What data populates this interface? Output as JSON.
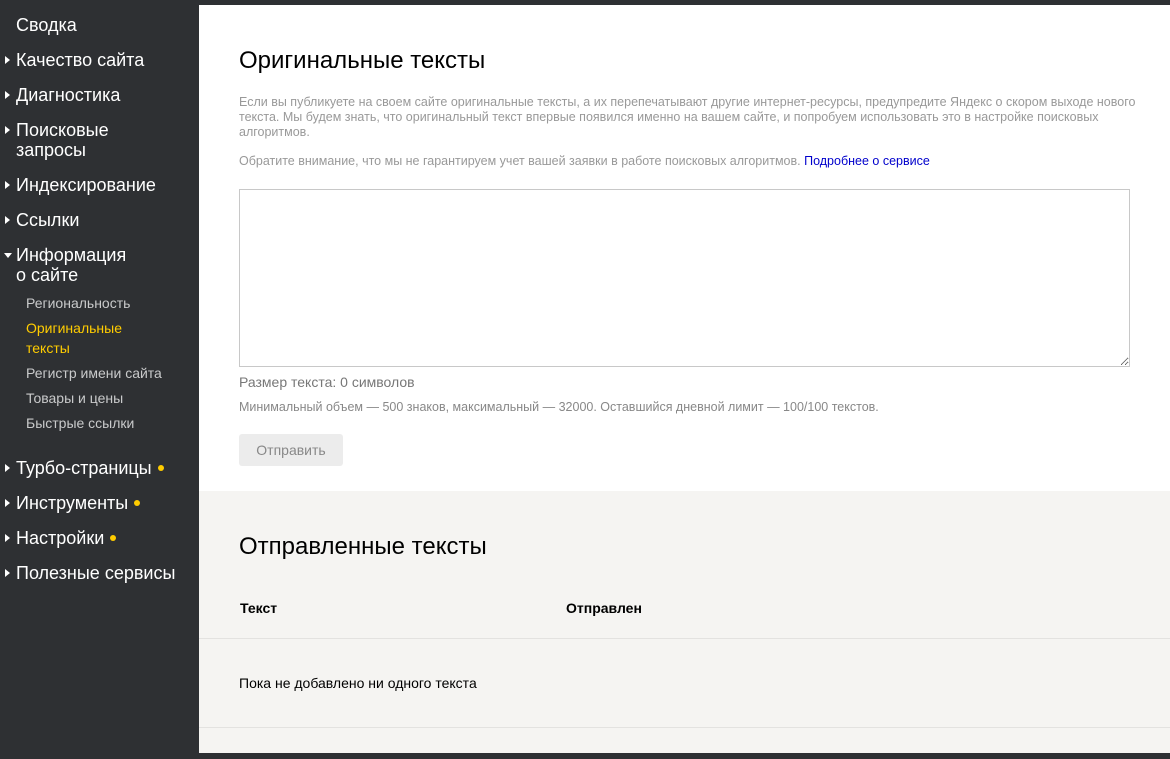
{
  "sidebar": {
    "items": [
      {
        "label": "Сводка"
      },
      {
        "label": "Качество сайта"
      },
      {
        "label": "Диагностика"
      },
      {
        "label_line1": "Поисковые",
        "label_line2": "запросы"
      },
      {
        "label": "Индексирование"
      },
      {
        "label": "Ссылки"
      },
      {
        "label_line1": "Информация",
        "label_line2": "о сайте"
      },
      {
        "label": "Турбо-страницы"
      },
      {
        "label": "Инструменты"
      },
      {
        "label": "Настройки"
      },
      {
        "label": "Полезные сервисы"
      }
    ],
    "subitems": [
      {
        "label": "Региональность"
      },
      {
        "label_line1": "Оригинальные",
        "label_line2": "тексты"
      },
      {
        "label": "Регистр имени сайта"
      },
      {
        "label": "Товары и цены"
      },
      {
        "label": "Быстрые ссылки"
      }
    ],
    "accent_color": "#ffcc00"
  },
  "original_texts": {
    "title": "Оригинальные тексты",
    "description": "Если вы публикуете на своем сайте оригинальные тексты, а их перепечатывают другие интернет-ресурсы, предупредите Яндекс о скором выходе нового текста. Мы будем знать, что оригинальный текст впервые появился именно на вашем сайте, и попробуем использовать это в настройке поисковых алгоритмов.",
    "notice": "Обратите внимание, что мы не гарантируем учет вашей заявки в работе поисковых алгоритмов.",
    "notice_link": "Подробнее о сервисе",
    "textarea_value": "",
    "size_text": "Размер текста: 0 символов",
    "limit_text": "Минимальный объем — 500 знаков, максимальный — 32000. Оставшийся дневной лимит — 100/100 текстов.",
    "send_label": "Отправить"
  },
  "sent_texts": {
    "title": "Отправленные тексты",
    "columns": [
      "Текст",
      "Отправлен"
    ],
    "empty_text": "Пока не добавлено ни одного текста"
  }
}
